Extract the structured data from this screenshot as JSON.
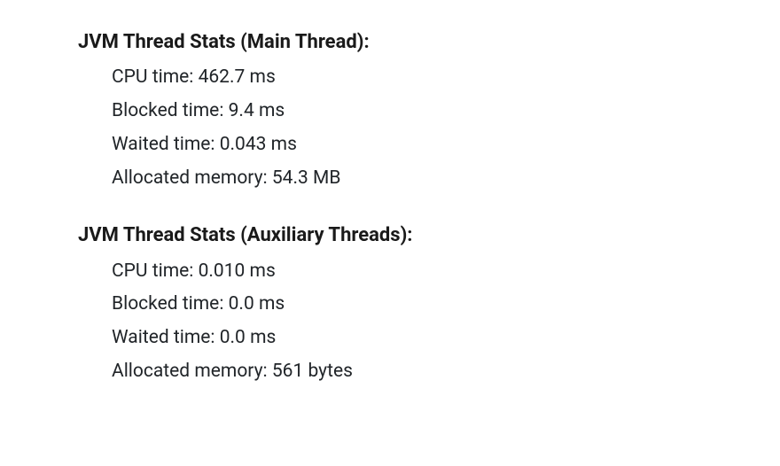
{
  "sections": [
    {
      "heading": "JVM Thread Stats (Main Thread):",
      "stats": [
        {
          "label": "CPU time: ",
          "value": "462.7 ms"
        },
        {
          "label": "Blocked time: ",
          "value": "9.4 ms"
        },
        {
          "label": "Waited time: ",
          "value": "0.043 ms"
        },
        {
          "label": "Allocated memory: ",
          "value": "54.3 MB"
        }
      ]
    },
    {
      "heading": "JVM Thread Stats (Auxiliary Threads):",
      "stats": [
        {
          "label": "CPU time: ",
          "value": "0.010 ms"
        },
        {
          "label": "Blocked time: ",
          "value": "0.0 ms"
        },
        {
          "label": "Waited time: ",
          "value": "0.0 ms"
        },
        {
          "label": "Allocated memory: ",
          "value": "561 bytes"
        }
      ]
    }
  ]
}
